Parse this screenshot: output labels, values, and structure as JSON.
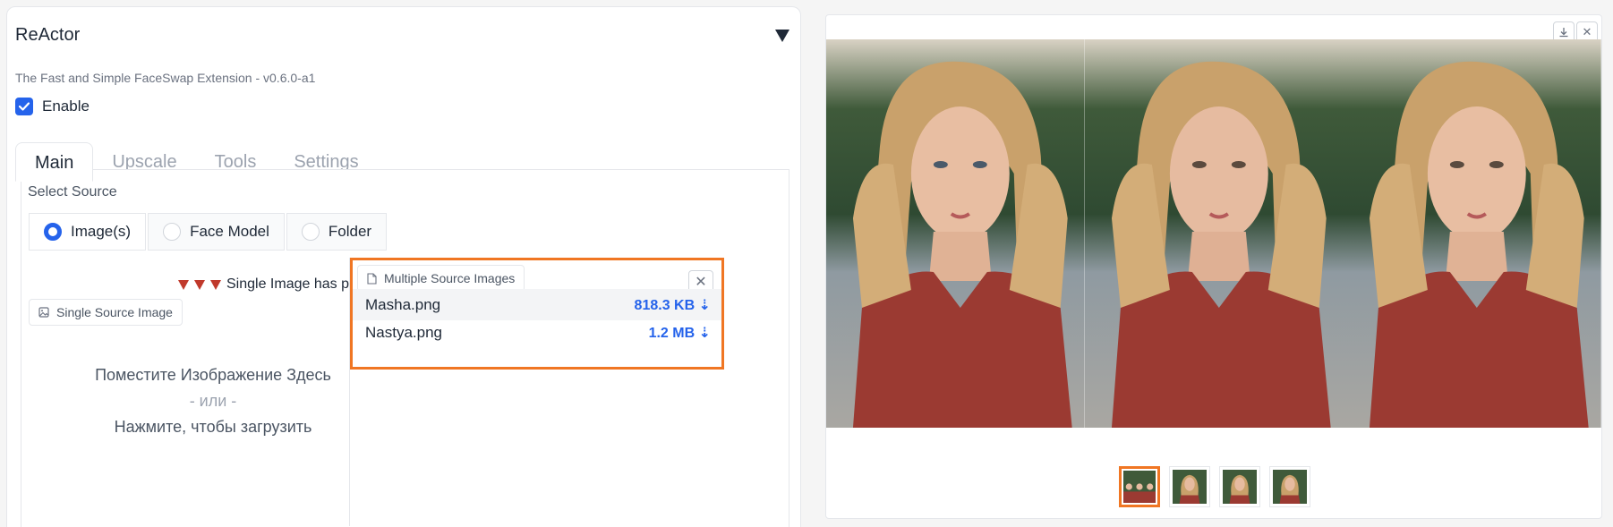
{
  "accordion": {
    "title": "ReActor",
    "subtitle": "The Fast and Simple FaceSwap Extension - v0.6.0-a1"
  },
  "enable": {
    "label": "Enable",
    "checked": true
  },
  "tabs": [
    {
      "label": "Main",
      "active": true
    },
    {
      "label": "Upscale",
      "active": false
    },
    {
      "label": "Tools",
      "active": false
    },
    {
      "label": "Settings",
      "active": false
    }
  ],
  "source": {
    "label": "Select Source",
    "options": [
      {
        "label": "Image(s)",
        "selected": true
      },
      {
        "label": "Face Model",
        "selected": false
      },
      {
        "label": "Folder",
        "selected": false
      }
    ]
  },
  "priority_note": "Single Image has priority when both Areas in use",
  "single_source": {
    "label": "Single Source Image",
    "drop_text": "Поместите Изображение Здесь",
    "or_text": "- или -",
    "click_text": "Нажмите, чтобы загрузить"
  },
  "multi_source": {
    "label": "Multiple Source Images",
    "files": [
      {
        "name": "Masha.png",
        "size": "818.3 KB ⇣"
      },
      {
        "name": "Nastya.png",
        "size": "1.2 MB ⇣"
      }
    ]
  },
  "gallery": {
    "thumb_count": 4,
    "selected_index": 0
  },
  "colors": {
    "accent": "#2563eb",
    "highlight": "#f07623",
    "shirt": "#9b3a32"
  },
  "icons": {
    "download": "download-icon",
    "close": "close-icon",
    "image": "image-icon",
    "file": "file-icon"
  }
}
